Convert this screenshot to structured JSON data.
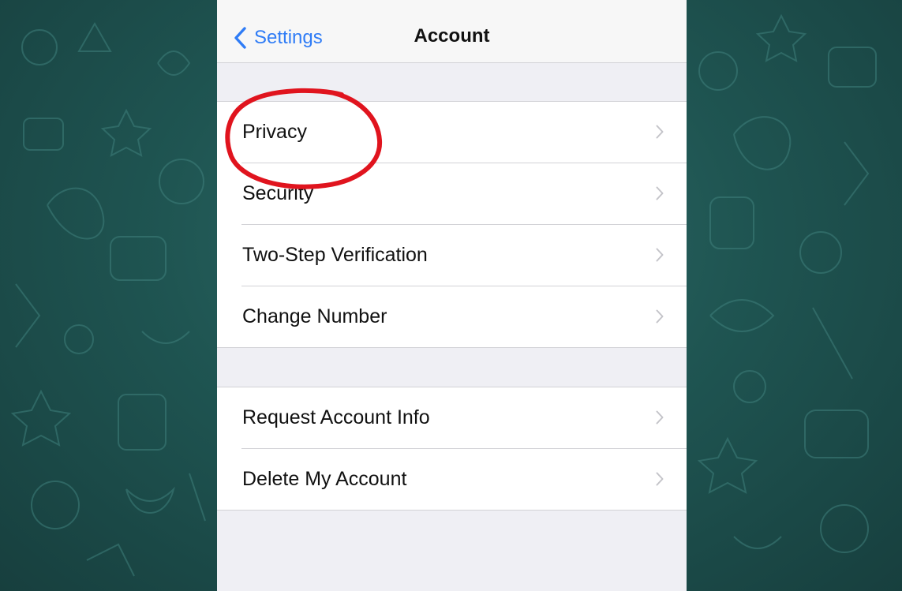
{
  "navbar": {
    "back_label": "Settings",
    "title": "Account"
  },
  "groups": [
    {
      "rows": [
        {
          "label": "Privacy"
        },
        {
          "label": "Security"
        },
        {
          "label": "Two-Step Verification"
        },
        {
          "label": "Change Number"
        }
      ]
    },
    {
      "rows": [
        {
          "label": "Request Account Info"
        },
        {
          "label": "Delete My Account"
        }
      ]
    }
  ],
  "colors": {
    "accent": "#2f7cf6",
    "annotation": "#e0141e",
    "wallpaper": "#1f5552"
  },
  "icons": {
    "back": "chevron-left-icon",
    "row": "chevron-right-icon"
  },
  "annotation": {
    "shape": "ellipse",
    "target": "Privacy"
  }
}
